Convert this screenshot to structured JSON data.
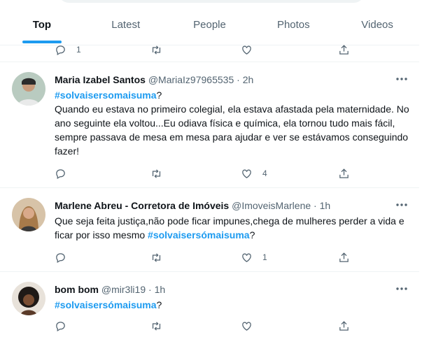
{
  "tabs": [
    {
      "label": "Top",
      "active": true
    },
    {
      "label": "Latest",
      "active": false
    },
    {
      "label": "People",
      "active": false
    },
    {
      "label": "Photos",
      "active": false
    },
    {
      "label": "Videos",
      "active": false
    }
  ],
  "partial_tweet": {
    "reply_count": "1"
  },
  "tweets": [
    {
      "name": "Maria Izabel Santos",
      "handle": "@MariaIz97965535",
      "dot": "·",
      "time": "2h",
      "hashtag": "#solvaisersomaisuma",
      "hashtag_suffix": "?",
      "text": "Quando eu estava no primeiro  colegial, ela estava afastada pela maternidade. No ano seguinte ela voltou...Eu odiava física e química, ela tornou tudo mais fácil, sempre passava de mesa em mesa para ajudar e ver se estávamos conseguindo fazer!",
      "reply_count": "",
      "retweet_count": "",
      "like_count": "4"
    },
    {
      "name": "Marlene Abreu - Corretora de Imóveis",
      "handle": "@ImoveisMarlene",
      "dot": "·",
      "time": "1h",
      "text_prefix": "Que seja feita justiça,não pode ficar impunes,chega de mulheres perder a vida e ficar por isso mesmo ",
      "hashtag": "#solvaisersómaisuma",
      "hashtag_suffix": "?",
      "reply_count": "",
      "retweet_count": "",
      "like_count": "1"
    },
    {
      "name": "bom bom",
      "handle": "@mir3li19",
      "dot": "·",
      "time": "1h",
      "hashtag": "#solvaisersómaisuma",
      "hashtag_suffix": "?",
      "reply_count": "",
      "retweet_count": "",
      "like_count": ""
    }
  ],
  "icons": {
    "reply": "reply-icon",
    "retweet": "retweet-icon",
    "like": "heart-icon",
    "share": "share-icon",
    "more": "more-icon"
  },
  "colors": {
    "accent": "#1d9bf0",
    "text": "#0f1419",
    "muted": "#536471",
    "divider": "#eff3f4"
  }
}
